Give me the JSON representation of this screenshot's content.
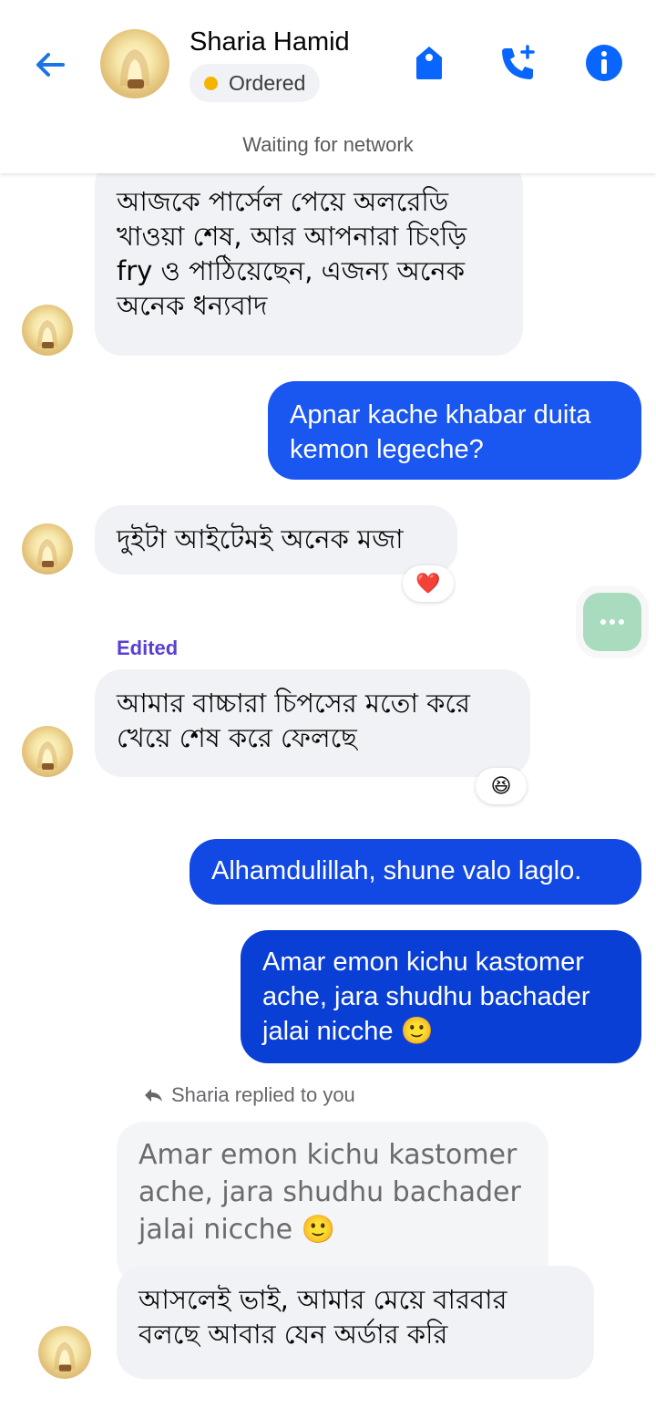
{
  "header": {
    "contact_name": "Sharia Hamid",
    "status_label": "Ordered",
    "network_status": "Waiting for network",
    "icons": [
      "back-arrow-icon",
      "tag-icon",
      "add-call-icon",
      "info-icon"
    ]
  },
  "colors": {
    "accent": "#1b74e4",
    "outgoing_bubble": "#1a56f0",
    "outgoing_bubble_dark": "#0a3fd6",
    "incoming_bubble": "#f0f2f5",
    "status_dot": "#f5b400",
    "edited": "#5b3fd1"
  },
  "messages": [
    {
      "direction": "in",
      "text": "আজকে পার্সেল পেয়ে অলরেডি\nখাওয়া শেষ, আর আপনারা চিংড়ি\nfry ও পাঠিয়েছেন, এজন্য অনেক\nঅনেক ধন্যবাদ"
    },
    {
      "direction": "out",
      "text": "Apnar kache khabar duita\nkemon legeche?"
    },
    {
      "direction": "in",
      "text": "দুইটা আইটেমই অনেক মজা",
      "reaction": "❤️"
    },
    {
      "direction": "in",
      "label": "Edited",
      "text": "আমার বাচ্চারা চিপসের মতো করে\nখেয়ে শেষ করে ফেলছে",
      "reaction": "😆"
    },
    {
      "direction": "out",
      "text": "Alhamdulillah, shune valo laglo."
    },
    {
      "direction": "out",
      "text": "Amar emon kichu kastomer\nache, jara shudhu bachader\njalai nicche 🙂"
    },
    {
      "direction": "in",
      "reply_label": "Sharia replied to you",
      "quoted": "Amar emon kichu kastomer\nache, jara shudhu bachader\njalai nicche 🙂",
      "text": "আসলেই ভাই, আমার মেয়ে বারবার\nবলছে আবার যেন অর্ডার করি"
    }
  ],
  "floating_button": {
    "icon": "more-dots-icon"
  }
}
